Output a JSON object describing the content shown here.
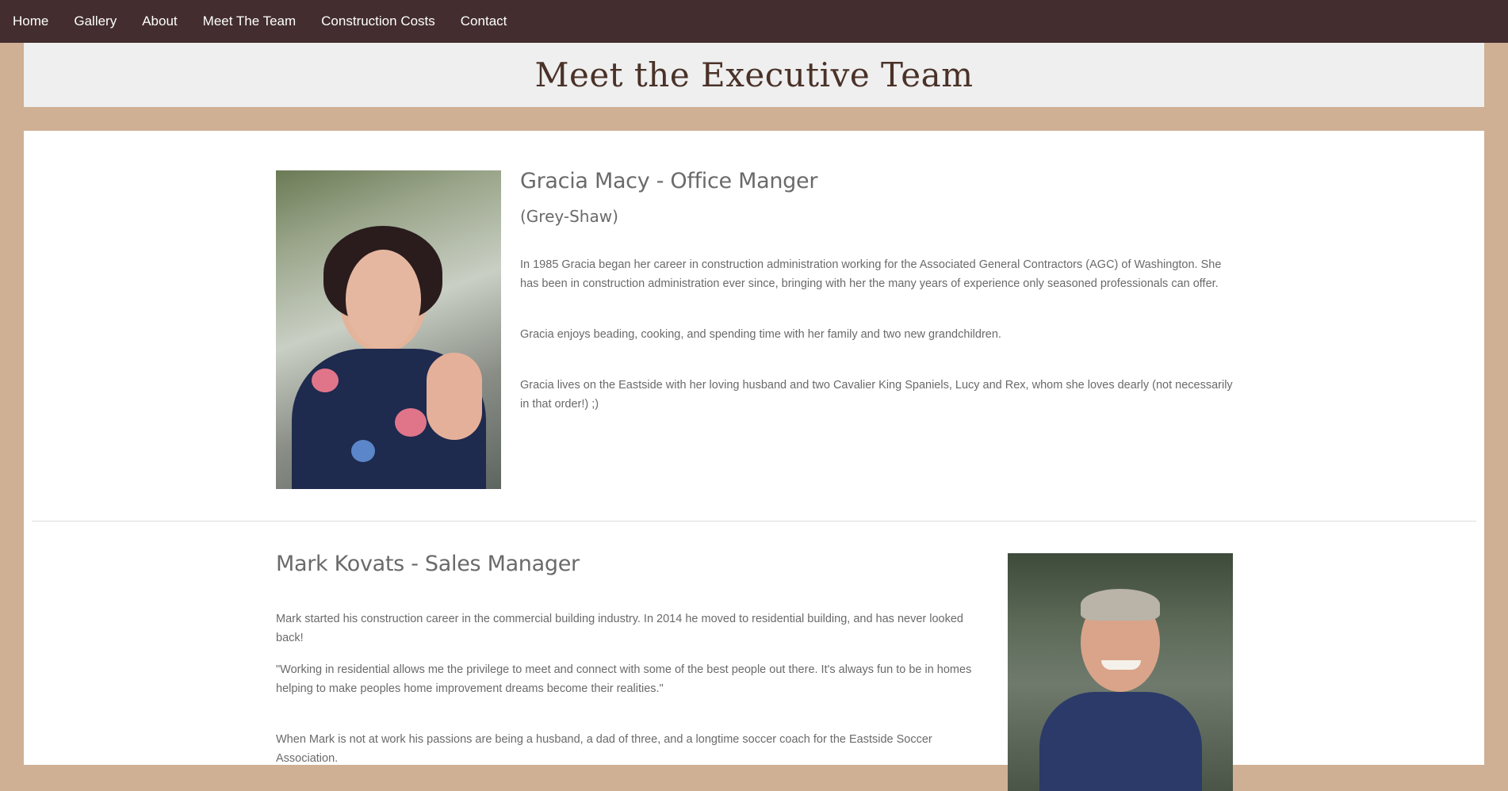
{
  "nav": {
    "items": [
      {
        "label": "Home"
      },
      {
        "label": "Gallery"
      },
      {
        "label": "About"
      },
      {
        "label": "Meet The Team"
      },
      {
        "label": "Construction Costs"
      },
      {
        "label": "Contact"
      }
    ]
  },
  "page": {
    "title": "Meet the Executive Team"
  },
  "members": [
    {
      "name": "Gracia Macy - Office Manger",
      "subname": "(Grey-Shaw)",
      "paragraphs": [
        "In 1985 Gracia began her career in construction administration working for the Associated General Contractors (AGC) of Washington. She has been in construction administration ever since, bringing with her the many years of experience only seasoned professionals can offer.",
        "Gracia enjoys beading, cooking, and spending time with her family and two new grandchildren.",
        "Gracia lives on the Eastside with her loving husband and two Cavalier King Spaniels, Lucy and Rex, whom she loves dearly (not necessarily in that order!) ;)"
      ]
    },
    {
      "name": "Mark Kovats - Sales Manager",
      "paragraphs": [
        "Mark started his construction career in the commercial building industry. In 2014 he moved to residential building, and has never looked back!",
        "\"Working in residential allows me the privilege to meet and connect with some of the best people out there. It's always fun to be in homes helping to make peoples home improvement dreams become their realities.\"",
        "When Mark is not at work his passions are being a husband, a dad of three, and a longtime soccer coach for the Eastside Soccer Association."
      ]
    }
  ],
  "colors": {
    "nav_bg": "#432d2e",
    "page_bg": "#cfb095",
    "title_band_bg": "#efefef",
    "title_color": "#4a3228"
  }
}
